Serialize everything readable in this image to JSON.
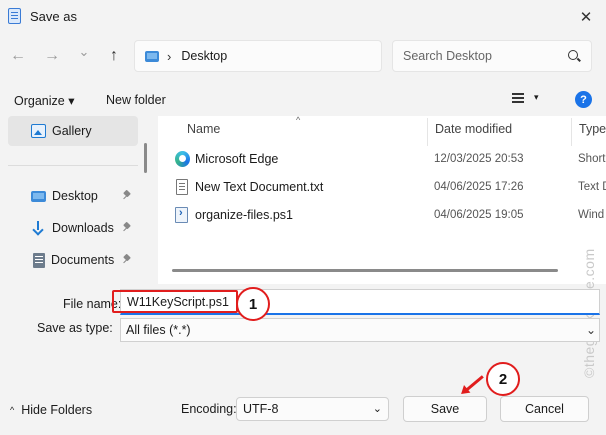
{
  "window": {
    "title": "Save as",
    "close_glyph": "✕"
  },
  "nav": {
    "back_glyph": "←",
    "forward_glyph": "→",
    "recent_glyph": "⌄",
    "up_glyph": "↑",
    "address_chevron": "›",
    "address": "Desktop",
    "search_placeholder": "Search Desktop"
  },
  "commands": {
    "organize": "Organize ▾",
    "new_folder": "New folder",
    "view_chevron": "▾",
    "help_glyph": "?"
  },
  "sidebar": {
    "items": [
      {
        "label": "Gallery",
        "icon": "gallery-icon",
        "pinned": false
      },
      {
        "label": "Desktop",
        "icon": "desktop-icon",
        "pinned": true
      },
      {
        "label": "Downloads",
        "icon": "downloads-icon",
        "pinned": true
      },
      {
        "label": "Documents",
        "icon": "documents-icon",
        "pinned": true
      }
    ]
  },
  "file_list": {
    "columns": {
      "name": "Name",
      "date": "Date modified",
      "type": "Type"
    },
    "sort_glyph": "^",
    "rows": [
      {
        "name": "Microsoft Edge",
        "date": "12/03/2025 20:53",
        "type": "Short",
        "icon": "edge-icon"
      },
      {
        "name": "New Text Document.txt",
        "date": "04/06/2025 17:26",
        "type": "Text D",
        "icon": "text-file-icon"
      },
      {
        "name": "organize-files.ps1",
        "date": "04/06/2025 19:05",
        "type": "Wind",
        "icon": "powershell-file-icon"
      }
    ]
  },
  "form": {
    "file_name_label": "File name:",
    "file_name_value": "W11KeyScript.ps1",
    "save_as_type_label": "Save as type:",
    "save_as_type_value": "All files  (*.*)",
    "type_chevron": "⌄"
  },
  "footer": {
    "hide_folders_chevron": "^",
    "hide_folders": "Hide Folders",
    "encoding_label": "Encoding:",
    "encoding_value": "UTF-8",
    "encoding_chevron": "⌄",
    "save": "Save",
    "cancel": "Cancel"
  },
  "annotations": {
    "step1": "1",
    "step2": "2",
    "highlight_color": "#e11d1d"
  },
  "watermark": "©thegeekpage.com",
  "colors": {
    "accent": "#1a73e8",
    "annotation_red": "#e11d1d",
    "background": "#f3f3f3"
  }
}
